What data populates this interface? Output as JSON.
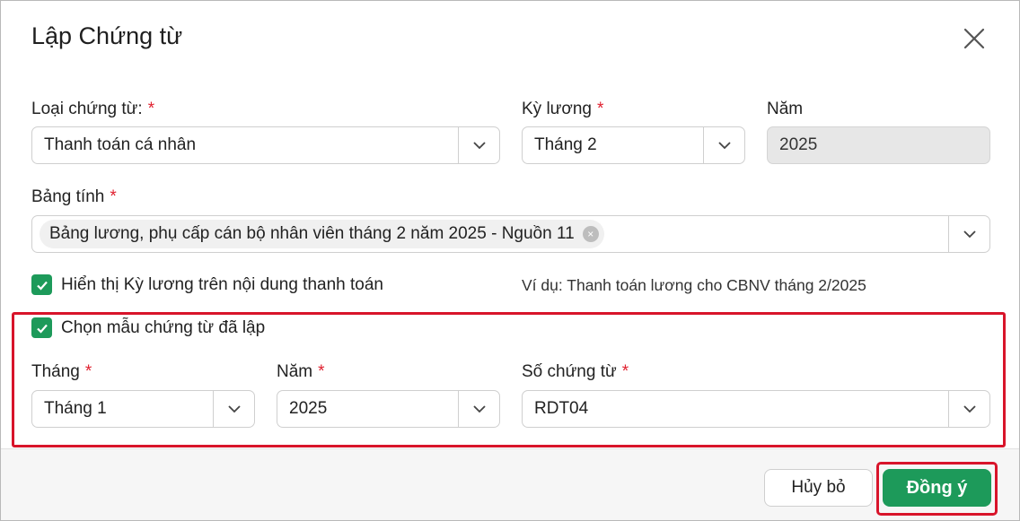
{
  "dialog": {
    "title": "Lập Chứng từ",
    "close_icon": "close-icon"
  },
  "form": {
    "loai_chung_tu": {
      "label": "Loại chứng từ:",
      "required": "*",
      "value": "Thanh toán cá nhân"
    },
    "ky_luong": {
      "label": "Kỳ lương",
      "required": "*",
      "value": "Tháng 2"
    },
    "nam": {
      "label": "Năm",
      "value": "2025"
    },
    "bang_tinh": {
      "label": "Bảng tính",
      "required": "*",
      "tag": "Bảng lương, phụ cấp cán bộ nhân viên tháng 2 năm 2025 - Nguồn 11",
      "tag_remove": "×"
    },
    "show_ky_luong": {
      "label": "Hiển thị Kỳ lương trên nội dung thanh toán",
      "checked": true
    },
    "example": "Ví dụ: Thanh toán lương cho CBNV tháng 2/2025",
    "chon_mau": {
      "label": "Chọn mẫu chứng từ đã lập",
      "checked": true
    },
    "mau_thang": {
      "label": "Tháng",
      "required": "*",
      "value": "Tháng 1"
    },
    "mau_nam": {
      "label": "Năm",
      "required": "*",
      "value": "2025"
    },
    "so_chung_tu": {
      "label": "Số chứng từ",
      "required": "*",
      "value": "RDT04"
    }
  },
  "footer": {
    "cancel_label": "Hủy bỏ",
    "ok_label": "Đồng ý"
  },
  "colors": {
    "accent": "#1d9a5a",
    "required": "#e0202f",
    "highlight": "#d8142a"
  }
}
